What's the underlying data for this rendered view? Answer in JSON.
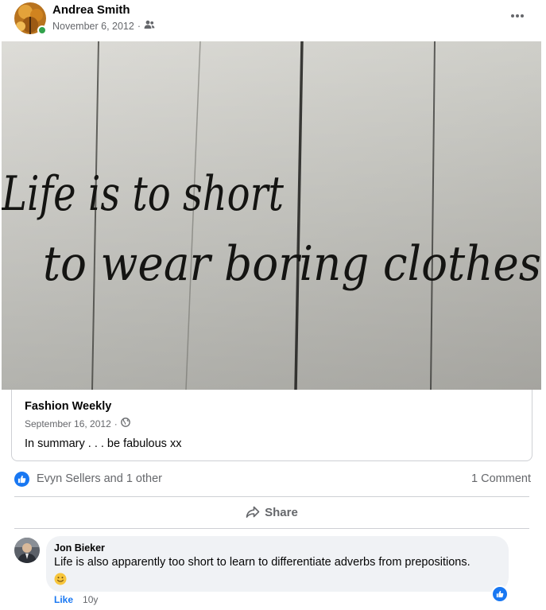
{
  "post": {
    "author": "Andrea Smith",
    "date": "November 6, 2012",
    "separator": "·",
    "audience_icon": "friends-icon",
    "more_icon": "more-horizontal-icon"
  },
  "photo": {
    "line1": "Life is to short",
    "line2": "to wear boring clothes"
  },
  "shared": {
    "source": "Fashion Weekly",
    "date": "September 16, 2012",
    "separator": "·",
    "audience_icon": "globe-icon",
    "text": "In summary . . . be fabulous xx"
  },
  "reactions": {
    "names": "Evyn Sellers and 1 other",
    "comments": "1 Comment",
    "colors": {
      "like": "#1877f2"
    }
  },
  "actions": {
    "share_label": "Share"
  },
  "comment": {
    "author": "Jon Bieker",
    "text": "Life is also apparently too short to learn to differentiate adverbs from prepositions.",
    "emoji": "slightly-smiling-face",
    "like_label": "Like",
    "time": "10y"
  }
}
